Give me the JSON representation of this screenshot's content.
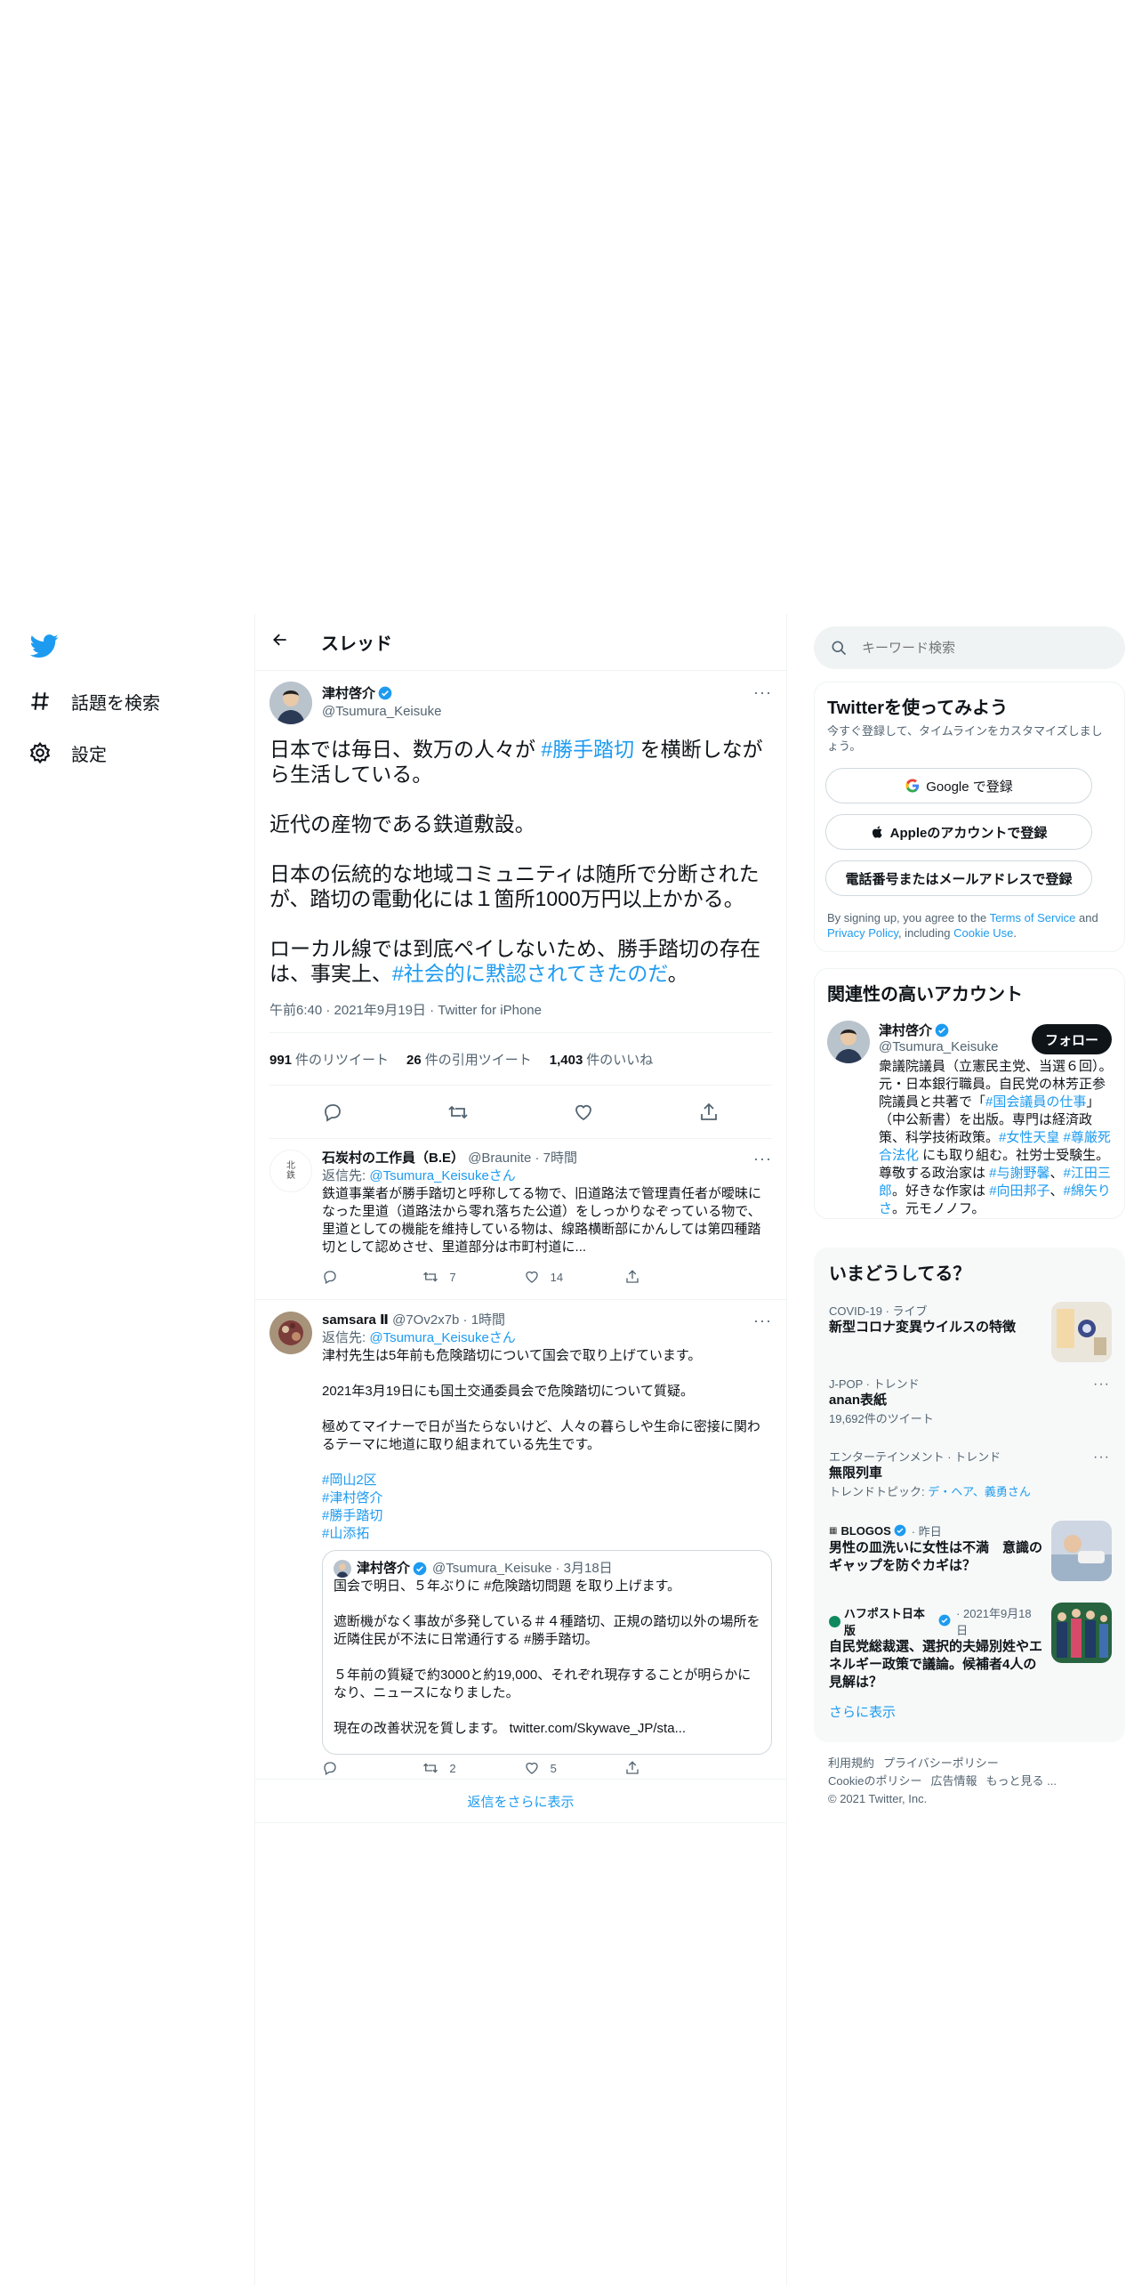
{
  "app": {
    "name": "Twitter"
  },
  "nav": {
    "explore_label": "話題を検索",
    "settings_label": "設定"
  },
  "header": {
    "title": "スレッド"
  },
  "main_tweet": {
    "author_name": "津村啓介",
    "author_handle": "@Tsumura_Keisuke",
    "paragraphs": [
      [
        "日本では毎日、数万の人々が ",
        "#勝手踏切",
        " を横断しながら生活している。"
      ],
      [
        "近代の産物である鉄道敷設。"
      ],
      [
        "日本の伝統的な地域コミュニティは随所で分断されたが、踏切の電動化には１箇所1000万円以上かかる。"
      ],
      [
        "ローカル線では到底ペイしないため、勝手踏切の存在は、事実上、",
        "#社会的に黙認されてきたのだ",
        "。"
      ]
    ],
    "p1_a": "日本では毎日、数万の人々が ",
    "p1_tag": "#勝手踏切",
    "p1_b": " を横断しながら生活している。",
    "p2": "近代の産物である鉄道敷設。",
    "p3": "日本の伝統的な地域コミュニティは随所で分断されたが、踏切の電動化には１箇所1000万円以上かかる。",
    "p4_a": "ローカル線では到底ペイしないため、勝手踏切の存在は、事実上、",
    "p4_tag": "#社会的に黙認されてきたのだ",
    "p4_b": "。",
    "meta": "午前6:40 · 2021年9月19日 · Twitter for iPhone",
    "retweets_count": "991",
    "retweets_label": "件のリツイート",
    "quotes_count": "26",
    "quotes_label": "件の引用ツイート",
    "likes_count": "1,403",
    "likes_label": "件のいいね"
  },
  "replies": [
    {
      "author_name": "石炭村の工作員（B.E）",
      "author_handle": "@Braunite",
      "time": "· 7時間",
      "reply_to_label": "返信先: ",
      "reply_to_handle": "@Tsumura_Keisukeさん",
      "text": "鉄道事業者が勝手踏切と呼称してる物で、旧道路法で管理責任者が曖昧になった里道（道路法から零れ落ちた公道）をしっかりなぞっている物で、里道としての機能を維持している物は、線路横断部にかんしては第四種踏切として認めさせ、里道部分は市町村道に...",
      "avatar_text": "北\n鉄",
      "retweets": "7",
      "likes": "14"
    },
    {
      "author_name": "samsara Ⅱ",
      "author_handle": "@7Ov2x7b",
      "time": "· 1時間",
      "reply_to_label": "返信先: ",
      "reply_to_handle": "@Tsumura_Keisukeさん",
      "line1": "津村先生は5年前も危険踏切について国会で取り上げています。",
      "line2": "2021年3月19日にも国土交通委員会で危険踏切について質疑。",
      "line3": "極めてマイナーで日が当たらないけど、人々の暮らしや生命に密接に関わるテーマに地道に取り組まれている先生です。",
      "tags": [
        "#岡山2区",
        "#津村啓介",
        "#勝手踏切",
        "#山添拓"
      ],
      "retweets": "2",
      "likes": "5",
      "quote": {
        "author_name": "津村啓介",
        "author_handle": "@Tsumura_Keisuke",
        "date": "· 3月18日",
        "line1": "国会で明日、５年ぶりに #危険踏切問題 を取り上げます。",
        "line2": "遮断機がなく事故が多発している＃４種踏切、正規の踏切以外の場所を近隣住民が不法に日常通行する #勝手踏切。",
        "line3": "５年前の質疑で約3000と約19,000、それぞれ現存することが明らかになり、ニュースになりました。",
        "line4": "現在の改善状況を質します。 twitter.com/Skywave_JP/sta..."
      }
    }
  ],
  "show_more_replies": "返信をさらに表示",
  "search": {
    "placeholder": "キーワード検索"
  },
  "signup": {
    "title": "Twitterを使ってみよう",
    "subtitle": "今すぐ登録して、タイムラインをカスタマイズしましょう。",
    "google": "Google で登録",
    "apple": "Appleのアカウントで登録",
    "phone": "電話番号またはメールアドレスで登録",
    "terms_a": "By signing up, you agree to the ",
    "terms_link": "Terms of Service",
    "terms_b": " and ",
    "privacy_link": "Privacy Policy",
    "terms_c": ", including ",
    "cookie_link": "Cookie Use",
    "terms_d": "."
  },
  "relevant": {
    "title": "関連性の高いアカウント",
    "name": "津村啓介",
    "handle": "@Tsumura_Keisuke",
    "follow": "フォロー",
    "bio_a": "衆議院議員（立憲民主党、当選６回）。元・日本銀行職員。自民党の林芳正参院議員と共著で「",
    "bio_link1": "#国会議員の仕事",
    "bio_b": "」（中公新書）を出版。専門は経済政策、科学技術政策。",
    "bio_link2": "#女性天皇",
    "bio_c": " ",
    "bio_link3": "#尊厳死合法化",
    "bio_d": " にも取り組む。社労士受験生。尊敬する政治家は ",
    "bio_link4": "#与謝野馨",
    "bio_e": "、",
    "bio_link5": "#江田三郎",
    "bio_f": "。好きな作家は ",
    "bio_link6": "#向田邦子",
    "bio_g": "、",
    "bio_link7": "#綿矢りさ",
    "bio_h": "。元モノノフ。"
  },
  "trends": {
    "title": "いまどうしてる？",
    "items": [
      {
        "category": "COVID-19 · ライブ",
        "title": "新型コロナ変異ウイルスの特徴"
      },
      {
        "category": "J-POP · トレンド",
        "title": "anan表紙",
        "count": "19,692件のツイート"
      },
      {
        "category": "エンターテインメント · トレンド",
        "title": "無限列車",
        "topic_label": "トレンドトピック: ",
        "topic": "デ・ヘア、義勇さん"
      },
      {
        "category": "BLOGOS",
        "time": "· 昨日",
        "title": "男性の皿洗いに女性は不満　意識のギャップを防ぐカギは？"
      },
      {
        "category": "ハフポスト日本版",
        "time": "· 2021年9月18日",
        "title": "自民党総裁選、選択的夫婦別姓やエネルギー政策で議論。候補者4人の見解は？"
      }
    ],
    "show_more": "さらに表示"
  },
  "footer": {
    "terms": "利用規約",
    "privacy": "プライバシーポリシー",
    "cookie": "Cookieのポリシー",
    "ads": "広告情報",
    "more": "もっと見る ...",
    "copyright": "© 2021 Twitter, Inc."
  },
  "colors": {
    "accent": "#1d9bf0",
    "text": "#0f1419",
    "muted": "#536471",
    "border": "#eff3f4"
  }
}
